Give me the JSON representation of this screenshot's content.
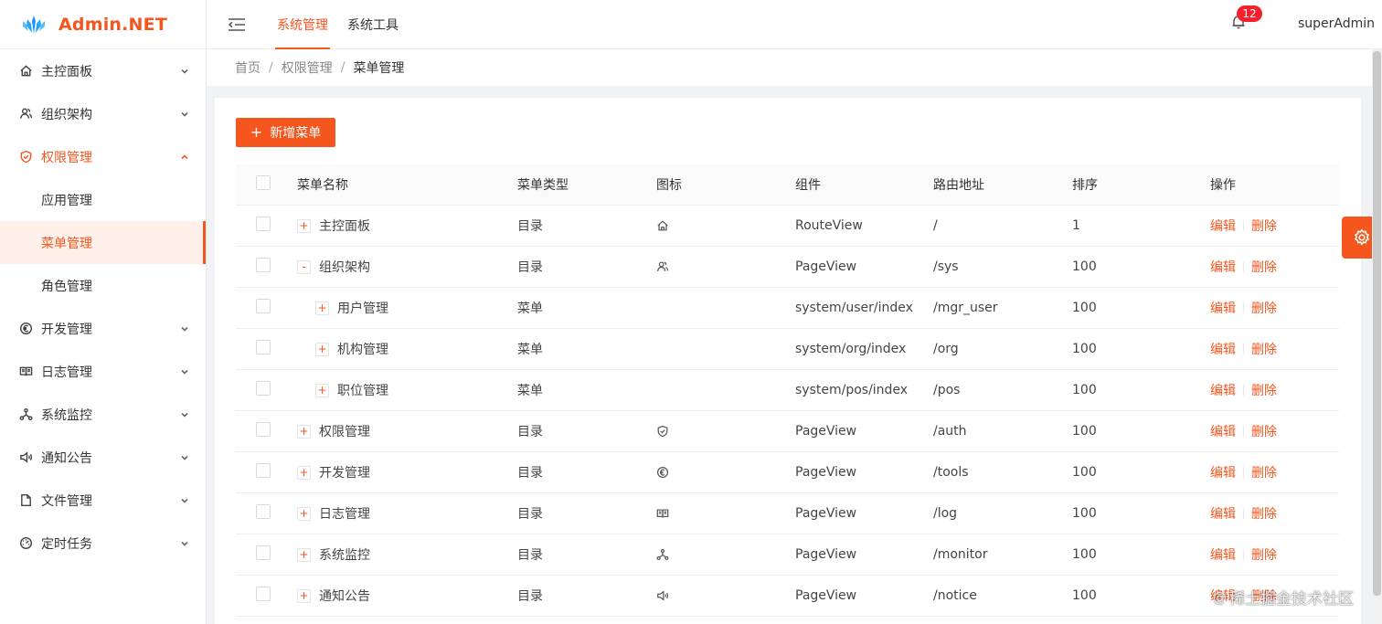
{
  "app": {
    "title": "Admin.NET"
  },
  "sidebar": {
    "items": [
      {
        "label": "主控面板",
        "icon": "home-icon"
      },
      {
        "label": "组织架构",
        "icon": "users-icon"
      },
      {
        "label": "权限管理",
        "icon": "shield-icon"
      },
      {
        "label": "开发管理",
        "icon": "euro-icon"
      },
      {
        "label": "日志管理",
        "icon": "book-icon"
      },
      {
        "label": "系统监控",
        "icon": "cluster-icon"
      },
      {
        "label": "通知公告",
        "icon": "sound-icon"
      },
      {
        "label": "文件管理",
        "icon": "file-icon"
      },
      {
        "label": "定时任务",
        "icon": "dashboard-icon"
      }
    ],
    "sub_items": [
      {
        "label": "应用管理"
      },
      {
        "label": "菜单管理"
      },
      {
        "label": "角色管理"
      }
    ]
  },
  "header": {
    "tabs": [
      {
        "label": "系统管理"
      },
      {
        "label": "系统工具"
      }
    ],
    "notifications_count": "12",
    "username": "superAdmin"
  },
  "breadcrumb": {
    "home": "首页",
    "parent": "权限管理",
    "current": "菜单管理"
  },
  "toolbar": {
    "add_label": "新增菜单"
  },
  "table": {
    "columns": [
      "菜单名称",
      "菜单类型",
      "图标",
      "组件",
      "路由地址",
      "排序",
      "操作"
    ],
    "rows": [
      {
        "name": "主控面板",
        "expand": "+",
        "level": 0,
        "type": "目录",
        "icon": "home-icon",
        "component": "RouteView",
        "route": "/",
        "sort": "1"
      },
      {
        "name": "组织架构",
        "expand": "-",
        "level": 0,
        "type": "目录",
        "icon": "users-icon",
        "component": "PageView",
        "route": "/sys",
        "sort": "100"
      },
      {
        "name": "用户管理",
        "expand": "+",
        "level": 1,
        "type": "菜单",
        "icon": "",
        "component": "system/user/index",
        "route": "/mgr_user",
        "sort": "100"
      },
      {
        "name": "机构管理",
        "expand": "+",
        "level": 1,
        "type": "菜单",
        "icon": "",
        "component": "system/org/index",
        "route": "/org",
        "sort": "100"
      },
      {
        "name": "职位管理",
        "expand": "+",
        "level": 1,
        "type": "菜单",
        "icon": "",
        "component": "system/pos/index",
        "route": "/pos",
        "sort": "100"
      },
      {
        "name": "权限管理",
        "expand": "+",
        "level": 0,
        "type": "目录",
        "icon": "shield-icon",
        "component": "PageView",
        "route": "/auth",
        "sort": "100"
      },
      {
        "name": "开发管理",
        "expand": "+",
        "level": 0,
        "type": "目录",
        "icon": "euro-icon",
        "component": "PageView",
        "route": "/tools",
        "sort": "100"
      },
      {
        "name": "日志管理",
        "expand": "+",
        "level": 0,
        "type": "目录",
        "icon": "book-icon",
        "component": "PageView",
        "route": "/log",
        "sort": "100"
      },
      {
        "name": "系统监控",
        "expand": "+",
        "level": 0,
        "type": "目录",
        "icon": "cluster-icon",
        "component": "PageView",
        "route": "/monitor",
        "sort": "100"
      },
      {
        "name": "通知公告",
        "expand": "+",
        "level": 0,
        "type": "目录",
        "icon": "sound-icon",
        "component": "PageView",
        "route": "/notice",
        "sort": "100"
      }
    ],
    "ops": {
      "edit": "编辑",
      "delete": "删除"
    }
  },
  "watermark": {
    "text": "稀土掘金技术社区"
  },
  "colors": {
    "accent": "#f5561e",
    "badge": "#f5222d"
  }
}
